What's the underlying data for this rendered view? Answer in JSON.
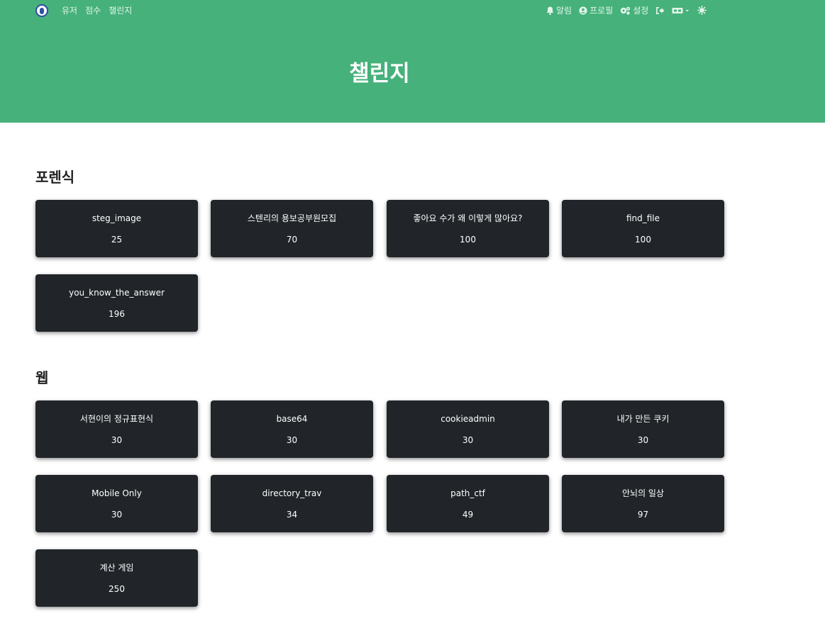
{
  "nav": {
    "logo": "logo-icon",
    "links": [
      "유저",
      "점수",
      "챌린지"
    ],
    "notifications": "알림",
    "profile": "프로필",
    "settings": "설정",
    "language": "language-icon",
    "theme": "theme-icon"
  },
  "hero": {
    "title": "챌린지"
  },
  "colors": {
    "header": "#46b17b",
    "card": "#212529"
  },
  "categories": [
    {
      "name": "포렌식",
      "challenges": [
        {
          "name": "steg_image",
          "value": "25"
        },
        {
          "name": "스텐리의 용보공부원모집",
          "value": "70"
        },
        {
          "name": "좋아요 수가 왜 이렇게 많아요?",
          "value": "100"
        },
        {
          "name": "find_file",
          "value": "100"
        },
        {
          "name": "you_know_the_answer",
          "value": "196"
        }
      ]
    },
    {
      "name": "웹",
      "challenges": [
        {
          "name": "서현이의 정규표현식",
          "value": "30"
        },
        {
          "name": "base64",
          "value": "30"
        },
        {
          "name": "cookieadmin",
          "value": "30"
        },
        {
          "name": "내가 만든 쿠키",
          "value": "30"
        },
        {
          "name": "Mobile Only",
          "value": "30"
        },
        {
          "name": "directory_trav",
          "value": "34"
        },
        {
          "name": "path_ctf",
          "value": "49"
        },
        {
          "name": "안뇌의 일상",
          "value": "97"
        },
        {
          "name": "계산 게임",
          "value": "250"
        }
      ]
    }
  ]
}
